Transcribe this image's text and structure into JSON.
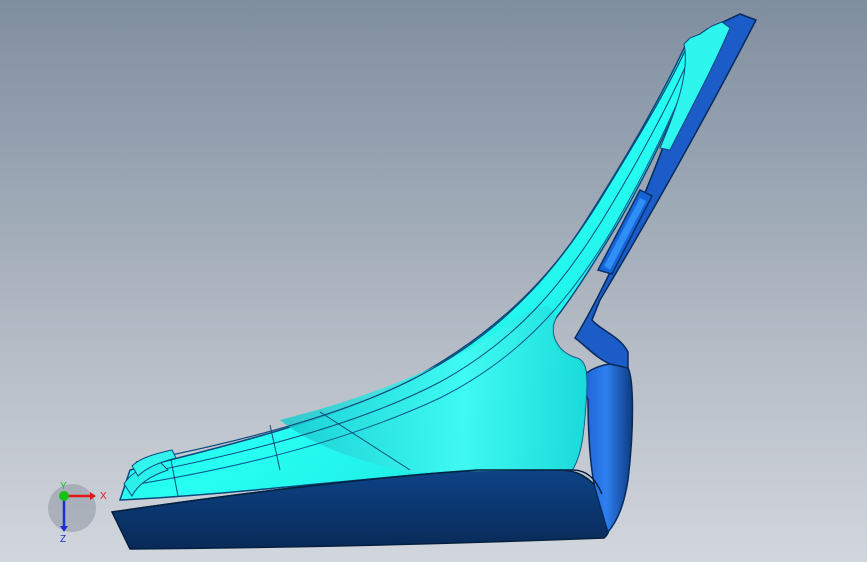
{
  "triad": {
    "x_label": "X",
    "y_label": "Y",
    "z_label": "Z",
    "x_color": "#e01818",
    "y_color": "#18c018",
    "z_color": "#1a2fd8"
  },
  "colors": {
    "part_face_light": "#22f4ee",
    "part_face_mid": "#19d9d6",
    "part_side_dark": "#0b3a78",
    "part_side_blue": "#1f5fcf"
  }
}
